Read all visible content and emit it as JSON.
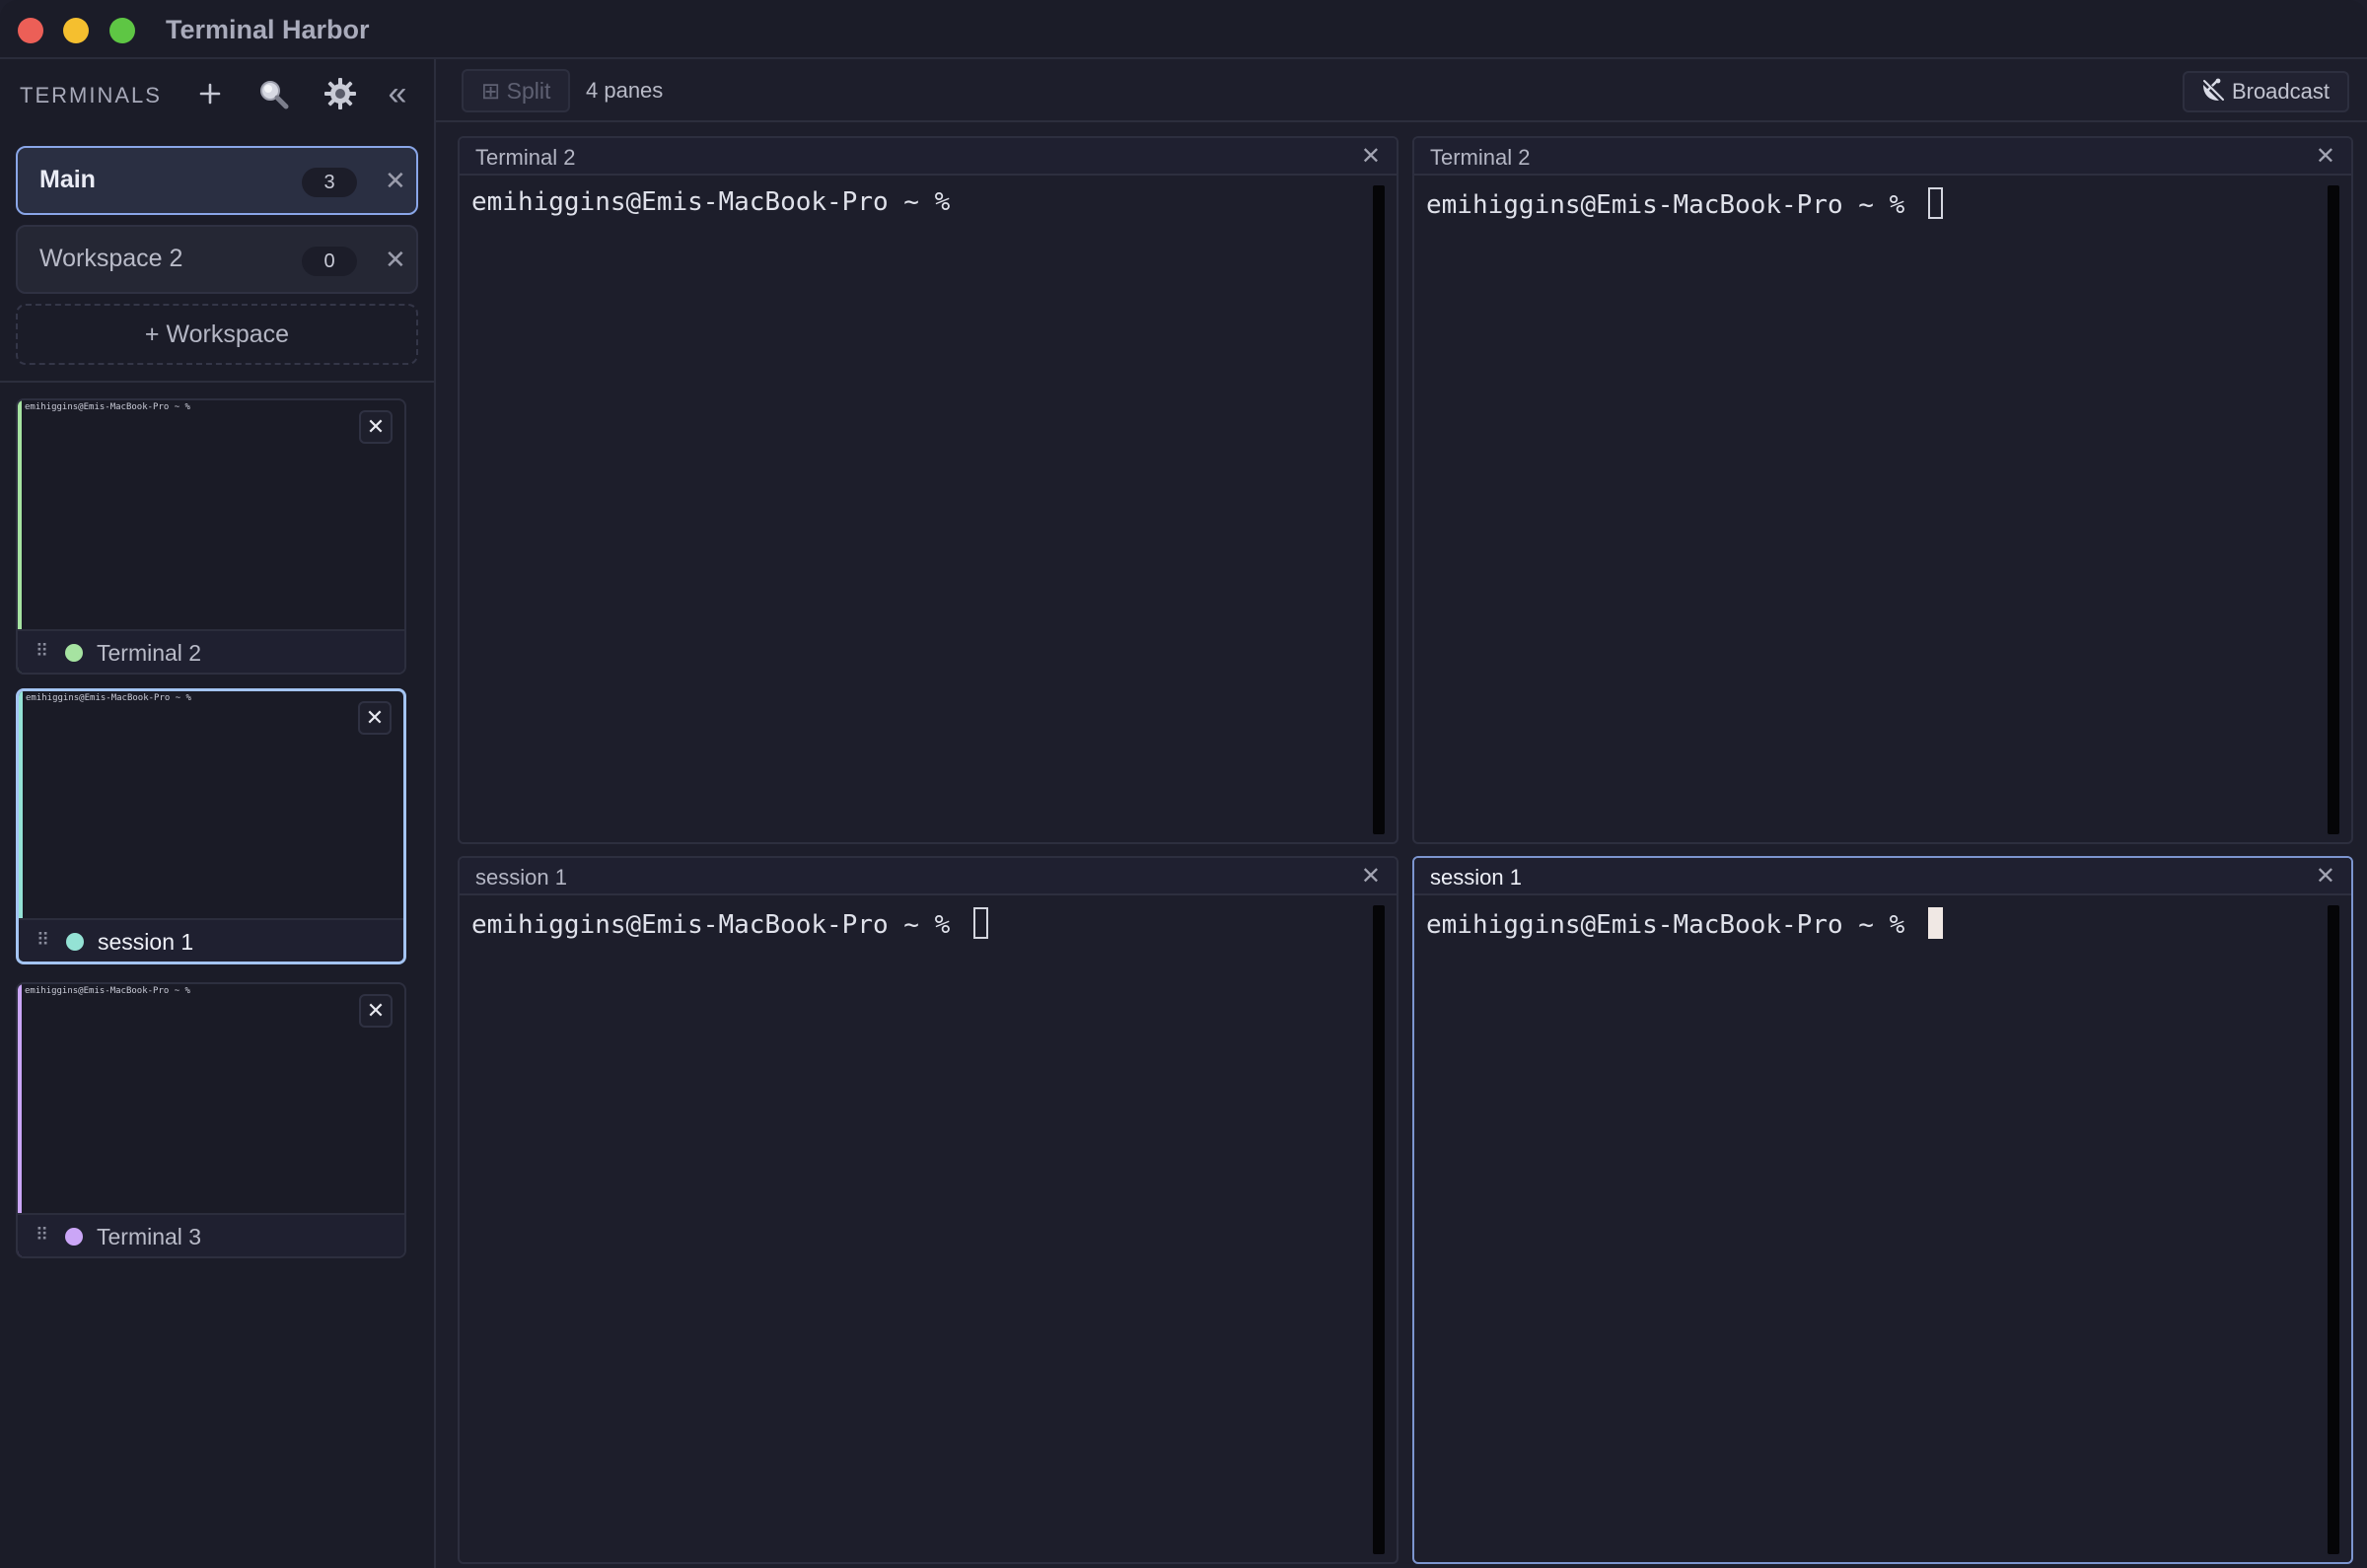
{
  "window": {
    "title": "Terminal Harbor"
  },
  "sidebar": {
    "title": "TERMINALS",
    "workspaces": [
      {
        "name": "Main",
        "count": "3",
        "active": true
      },
      {
        "name": "Workspace 2",
        "count": "0",
        "active": false
      }
    ],
    "add_workspace_label": "+ Workspace",
    "terminals": [
      {
        "label": "Terminal 2",
        "preview": "emihiggins@Emis-MacBook-Pro ~ %",
        "dot_color": "#a6e3a1",
        "accent_color": "#a6e3a1",
        "selected": false
      },
      {
        "label": "session 1",
        "preview": "emihiggins@Emis-MacBook-Pro ~ %",
        "dot_color": "#94e2d5",
        "accent_color": "#94e2d5",
        "selected": true
      },
      {
        "label": "Terminal 3",
        "preview": "emihiggins@Emis-MacBook-Pro ~ %",
        "dot_color": "#cba6f7",
        "accent_color": "#cba6f7",
        "selected": false
      }
    ]
  },
  "toolbar": {
    "split_label": "⊞ Split",
    "panes_label": "4 panes",
    "broadcast_label": "Broadcast"
  },
  "panes": [
    {
      "title": "Terminal 2",
      "prompt": "emihiggins@Emis-MacBook-Pro ~ % ",
      "cursor": "none",
      "focused": false
    },
    {
      "title": "Terminal 2",
      "prompt": "emihiggins@Emis-MacBook-Pro ~ % ",
      "cursor": "hollow",
      "focused": false
    },
    {
      "title": "session 1",
      "prompt": "emihiggins@Emis-MacBook-Pro ~ % ",
      "cursor": "hollow",
      "focused": false
    },
    {
      "title": "session 1",
      "prompt": "emihiggins@Emis-MacBook-Pro ~ % ",
      "cursor": "solid",
      "focused": true
    }
  ],
  "icons": {
    "add": "plus-icon",
    "search": "magnifier-icon",
    "settings": "gear-icon",
    "collapse": "double-chevron-left-icon",
    "broadcast": "satellite-dish-icon",
    "drag": "grip-icon",
    "close": "x-icon"
  },
  "colors": {
    "focus_border": "#7c95cf",
    "active_workspace_border": "#8aa6e8",
    "traffic_red": "#ec5f57",
    "traffic_yellow": "#f5bf2f",
    "traffic_green": "#5ec644"
  }
}
